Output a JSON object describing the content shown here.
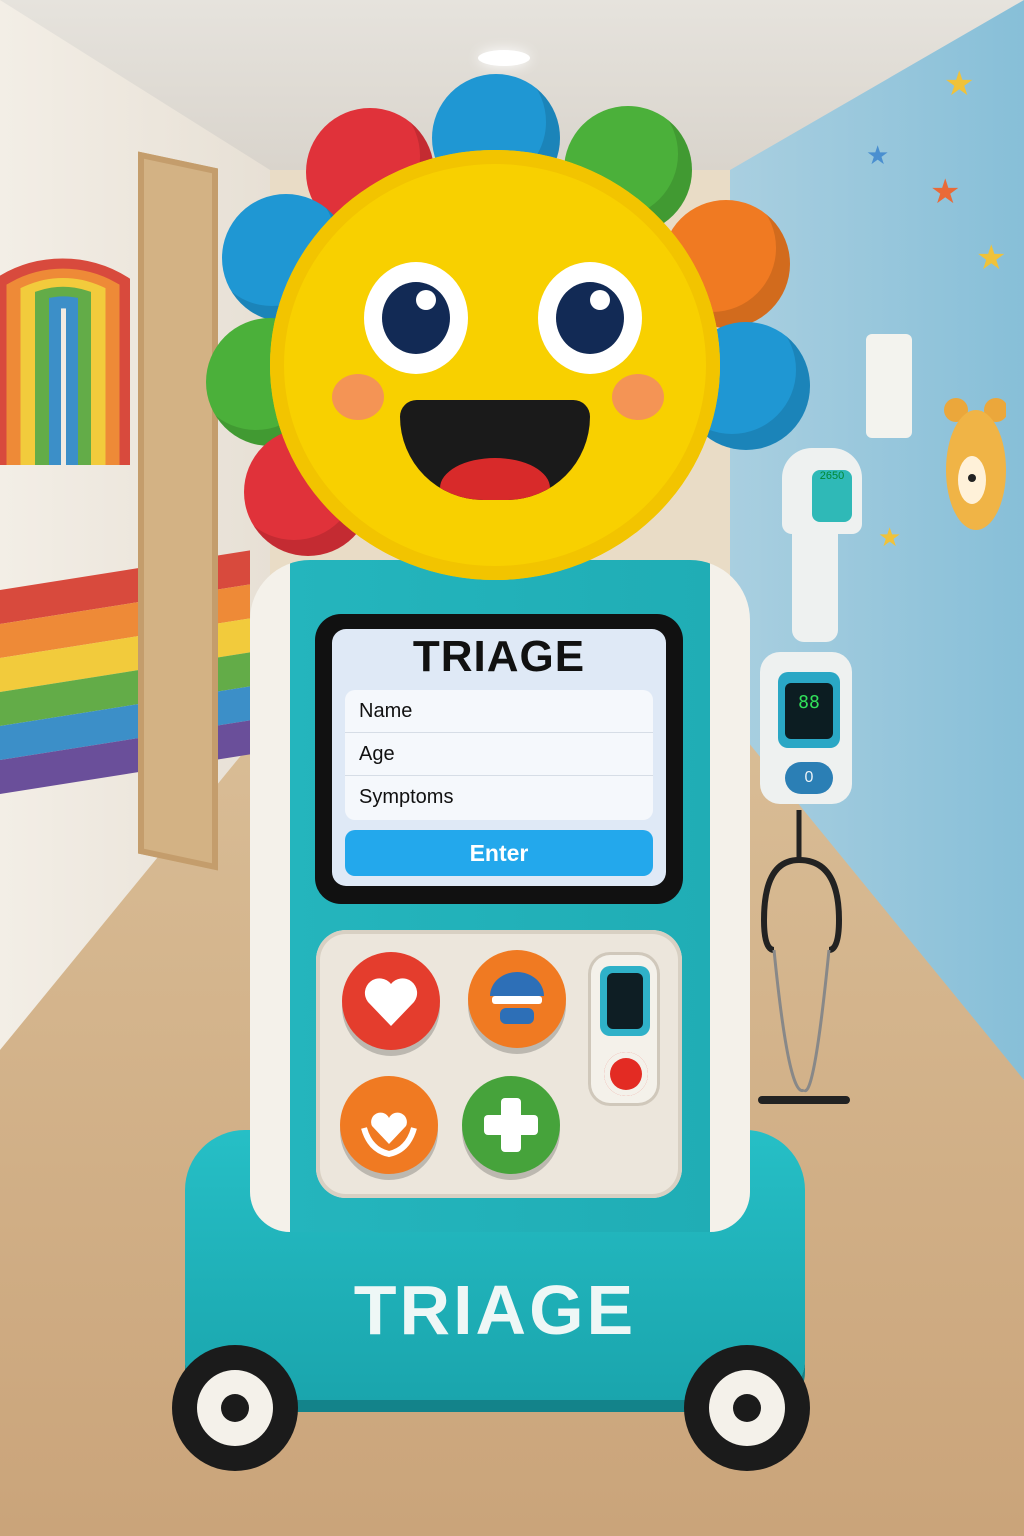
{
  "screen": {
    "title": "TRIAGE",
    "fields": [
      "Name",
      "Age",
      "Symptoms"
    ],
    "enter_label": "Enter"
  },
  "base_label": "TRIAGE",
  "oximeter": {
    "lcd": "88",
    "button": "0"
  },
  "thermometer": {
    "lcd": "2650"
  },
  "colors": {
    "body_teal": "#22b3bb",
    "face_yellow": "#f8d000",
    "enter_blue": "#23a8ec"
  },
  "panel_buttons": [
    "heart-icon",
    "helmet-icon",
    "heart-hands-icon",
    "plus-icon"
  ]
}
